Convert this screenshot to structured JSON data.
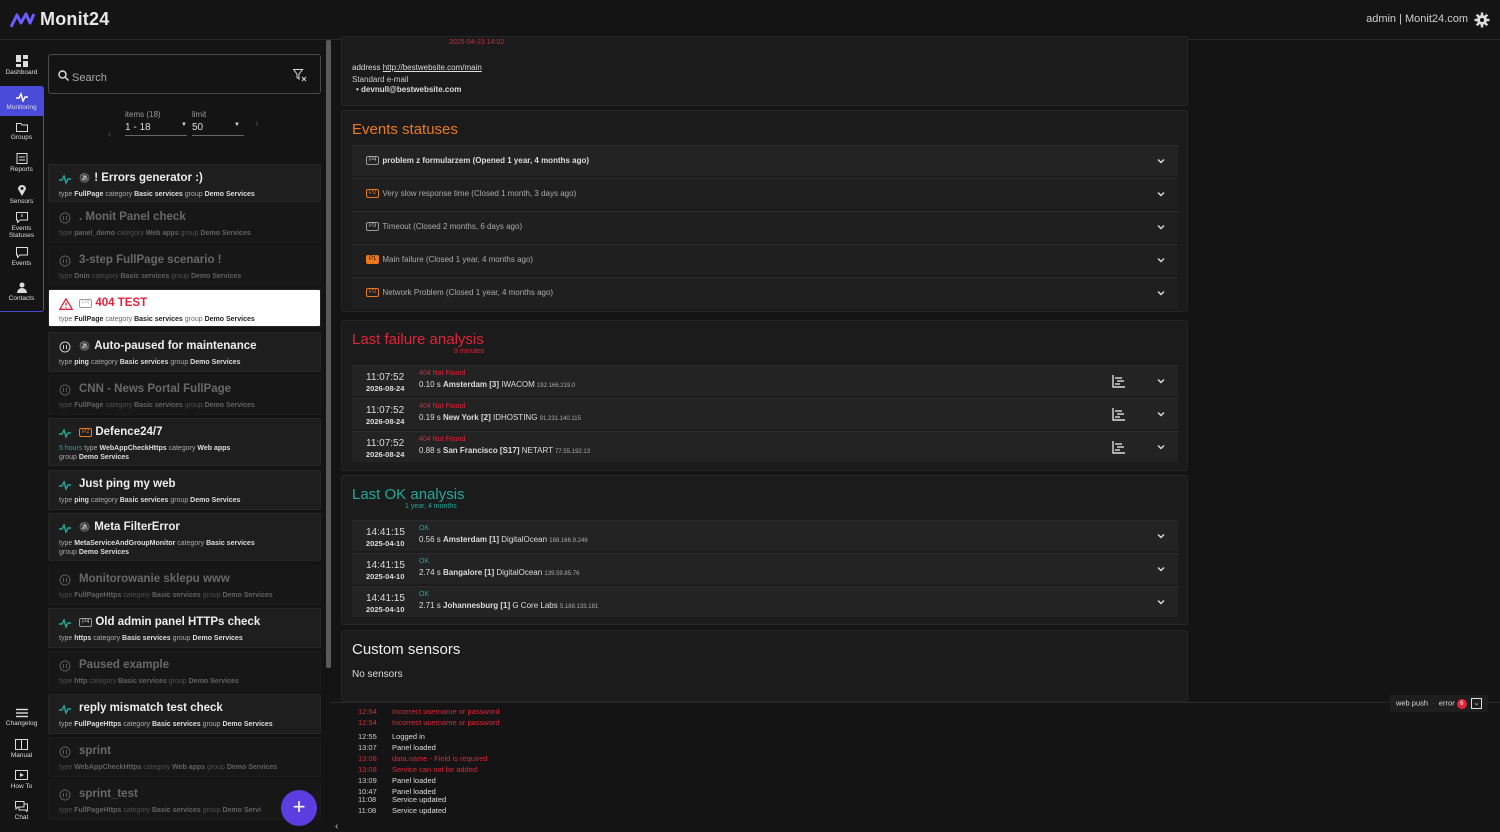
{
  "topbar": {
    "logo_text": "Monit24",
    "user": "admin | Monit24.com"
  },
  "nav": [
    {
      "label": "Dashboard"
    },
    {
      "label": "Monitoring"
    },
    {
      "label": "Groups"
    },
    {
      "label": "Reports"
    },
    {
      "label": "Sensors"
    },
    {
      "label": "Events",
      "label2": "Statuses"
    },
    {
      "label": "Events"
    },
    {
      "label": "Contacts"
    },
    {
      "label": "Changelog"
    },
    {
      "label": "Manual"
    },
    {
      "label": "How To"
    },
    {
      "label": "Chat"
    }
  ],
  "list": {
    "search_placeholder": "Search",
    "items_label": "items (18)",
    "items_value": "1 - 18",
    "limit_label": "limit",
    "limit_value": "50",
    "cards": [
      {
        "title": "! Errors generator :)",
        "l1": [
          "type",
          "FullPage",
          "category",
          "Basic services",
          "group",
          "Demo Services"
        ]
      },
      {
        "title": ". Monit Panel check",
        "l1": [
          "type",
          "panel_demo",
          "category",
          "Web apps",
          "group",
          "Demo Services"
        ]
      },
      {
        "title": "3-step FullPage scenario !",
        "l1": [
          "type",
          "Dnin",
          "category",
          "Basic services",
          "group",
          "Demo Services"
        ]
      },
      {
        "badge": "P4",
        "title": "404 TEST",
        "l1": [
          "type",
          "FullPage",
          "category",
          "Basic services",
          "group",
          "Demo Services"
        ]
      },
      {
        "title": "Auto-paused for maintenance",
        "l1": [
          "type",
          "ping",
          "category",
          "Basic services",
          "group",
          "Demo Services"
        ]
      },
      {
        "title": "CNN - News Portal FullPage",
        "l1": [
          "type",
          "FullPage",
          "category",
          "Basic services",
          "group",
          "Demo Services"
        ]
      },
      {
        "badge": "P2",
        "title": "Defence24/7",
        "pre": "5 hours",
        "l1": [
          "type",
          "WebAppCheckHttps",
          "category",
          "Web apps"
        ],
        "l2": [
          "group",
          "Demo Services"
        ]
      },
      {
        "title": "Just ping my web",
        "l1": [
          "type",
          "ping",
          "category",
          "Basic services",
          "group",
          "Demo Services"
        ]
      },
      {
        "title": "Meta FilterError",
        "l1": [
          "type",
          "MetaServiceAndGroupMonitor",
          "category",
          "Basic services"
        ],
        "l2": [
          "group",
          "Demo Services"
        ]
      },
      {
        "title": "Monitorowanie sklepu www",
        "l1": [
          "type",
          "FullPageHttps",
          "category",
          "Basic services",
          "group",
          "Demo Services"
        ]
      },
      {
        "badge": "P4",
        "title": "Old admin panel HTTPs check",
        "l1": [
          "type",
          "https",
          "category",
          "Basic services",
          "group",
          "Demo Services"
        ]
      },
      {
        "title": "Paused example",
        "l1": [
          "type",
          "http",
          "category",
          "Basic services",
          "group",
          "Demo Services"
        ]
      },
      {
        "title": "reply mismatch test check",
        "l1": [
          "type",
          "FullPageHttps",
          "category",
          "Basic services",
          "group",
          "Demo Services"
        ]
      },
      {
        "title": "sprint",
        "l1": [
          "type",
          "WebAppCheckHttps",
          "category",
          "Web apps",
          "group",
          "Demo Services"
        ]
      },
      {
        "title": "sprint_test",
        "l1": [
          "type",
          "FullPageHttps",
          "category",
          "Basic services",
          "group",
          "Demo Servi"
        ]
      }
    ],
    "fab": "+"
  },
  "detail": {
    "top_date": "2025-04-23 14:02",
    "address_label": "address",
    "address_url": "http://bestwebsite.com/main",
    "email_label": "Standard e-mail",
    "email": "devnull@bestwebsite.com",
    "events_title": "Events statuses",
    "events": [
      {
        "p": "P4",
        "name": "problem z formularzem",
        "info": "(Opened 1 year, 4 months ago)"
      },
      {
        "p": "P2",
        "name": "Very slow response time",
        "info": "(Closed 1 month, 3 days ago)"
      },
      {
        "p": "P3",
        "name": "Timeout",
        "info": "(Closed 2 months, 6 days ago)"
      },
      {
        "p": "P1",
        "name": "Main failure",
        "info": "(Closed 1 year, 4 months ago)"
      },
      {
        "p": "P2",
        "name": "Network Problem",
        "info": "(Closed 1 year, 4 months ago)"
      }
    ],
    "fail_title": "Last failure analysis",
    "fail_sub": "9 minutes",
    "fails": [
      {
        "time": "11:07:52",
        "date": "2026-08-24",
        "status": "404 Not Found",
        "dur": "0.10 s",
        "city": "Amsterdam [3]",
        "prov": "IWACOM",
        "ip": "192.166.219.0"
      },
      {
        "time": "11:07:52",
        "date": "2026-08-24",
        "status": "404 Not Found",
        "dur": "0.19 s",
        "city": "New York [2]",
        "prov": "IDHOSTING",
        "ip": "91.231.140.115"
      },
      {
        "time": "11:07:52",
        "date": "2026-08-24",
        "status": "404 Not Found",
        "dur": "0.88 s",
        "city": "San Francisco [S17]",
        "prov": "NETART",
        "ip": "77.55.192.13"
      }
    ],
    "ok_title": "Last OK analysis",
    "ok_sub": "1 year, 4 months",
    "oks": [
      {
        "time": "14:41:15",
        "date": "2025-04-10",
        "status": "OK",
        "dur": "0.56 s",
        "city": "Amsterdam [1]",
        "prov": "DigitalOcean",
        "ip": "188.166.9.246"
      },
      {
        "time": "14:41:15",
        "date": "2025-04-10",
        "status": "OK",
        "dur": "2.74 s",
        "city": "Bangalore [1]",
        "prov": "DigitalOcean",
        "ip": "139.59.85.76"
      },
      {
        "time": "14:41:15",
        "date": "2025-04-10",
        "status": "OK",
        "dur": "2.71 s",
        "city": "Johannesburg [1]",
        "prov": "G Core Labs",
        "ip": "5.188.133.181"
      }
    ],
    "custom_title": "Custom sensors",
    "custom_text": "No sensors"
  },
  "log": {
    "web_push": "web push",
    "error_label": "error",
    "error_count": "6",
    "entries": [
      {
        "t": "12:54",
        "msg": "Incorrect username or password",
        "err": true
      },
      {
        "t": "12:54",
        "msg": "Incorrect username or password",
        "err": true
      },
      {
        "t": "12:55",
        "msg": "Logged in",
        "err": false
      },
      {
        "t": "13:07",
        "msg": "Panel loaded",
        "err": false
      },
      {
        "t": "13:08",
        "msg": "data.name - Field is required",
        "err": true
      },
      {
        "t": "13:08",
        "msg": "Service can not be added",
        "err": true
      },
      {
        "t": "13:09",
        "msg": "Panel loaded",
        "err": false
      },
      {
        "t": "10:47",
        "msg": "Panel loaded",
        "err": false
      },
      {
        "t": "11:08",
        "msg": "Service updated",
        "err": false
      },
      {
        "t": "11:08",
        "msg": "Service updated",
        "err": false
      }
    ]
  },
  "colors": {
    "accent": "#4a4ad8",
    "orange": "#ee7a1c",
    "red": "#e0243b",
    "teal": "#1fa99a"
  }
}
